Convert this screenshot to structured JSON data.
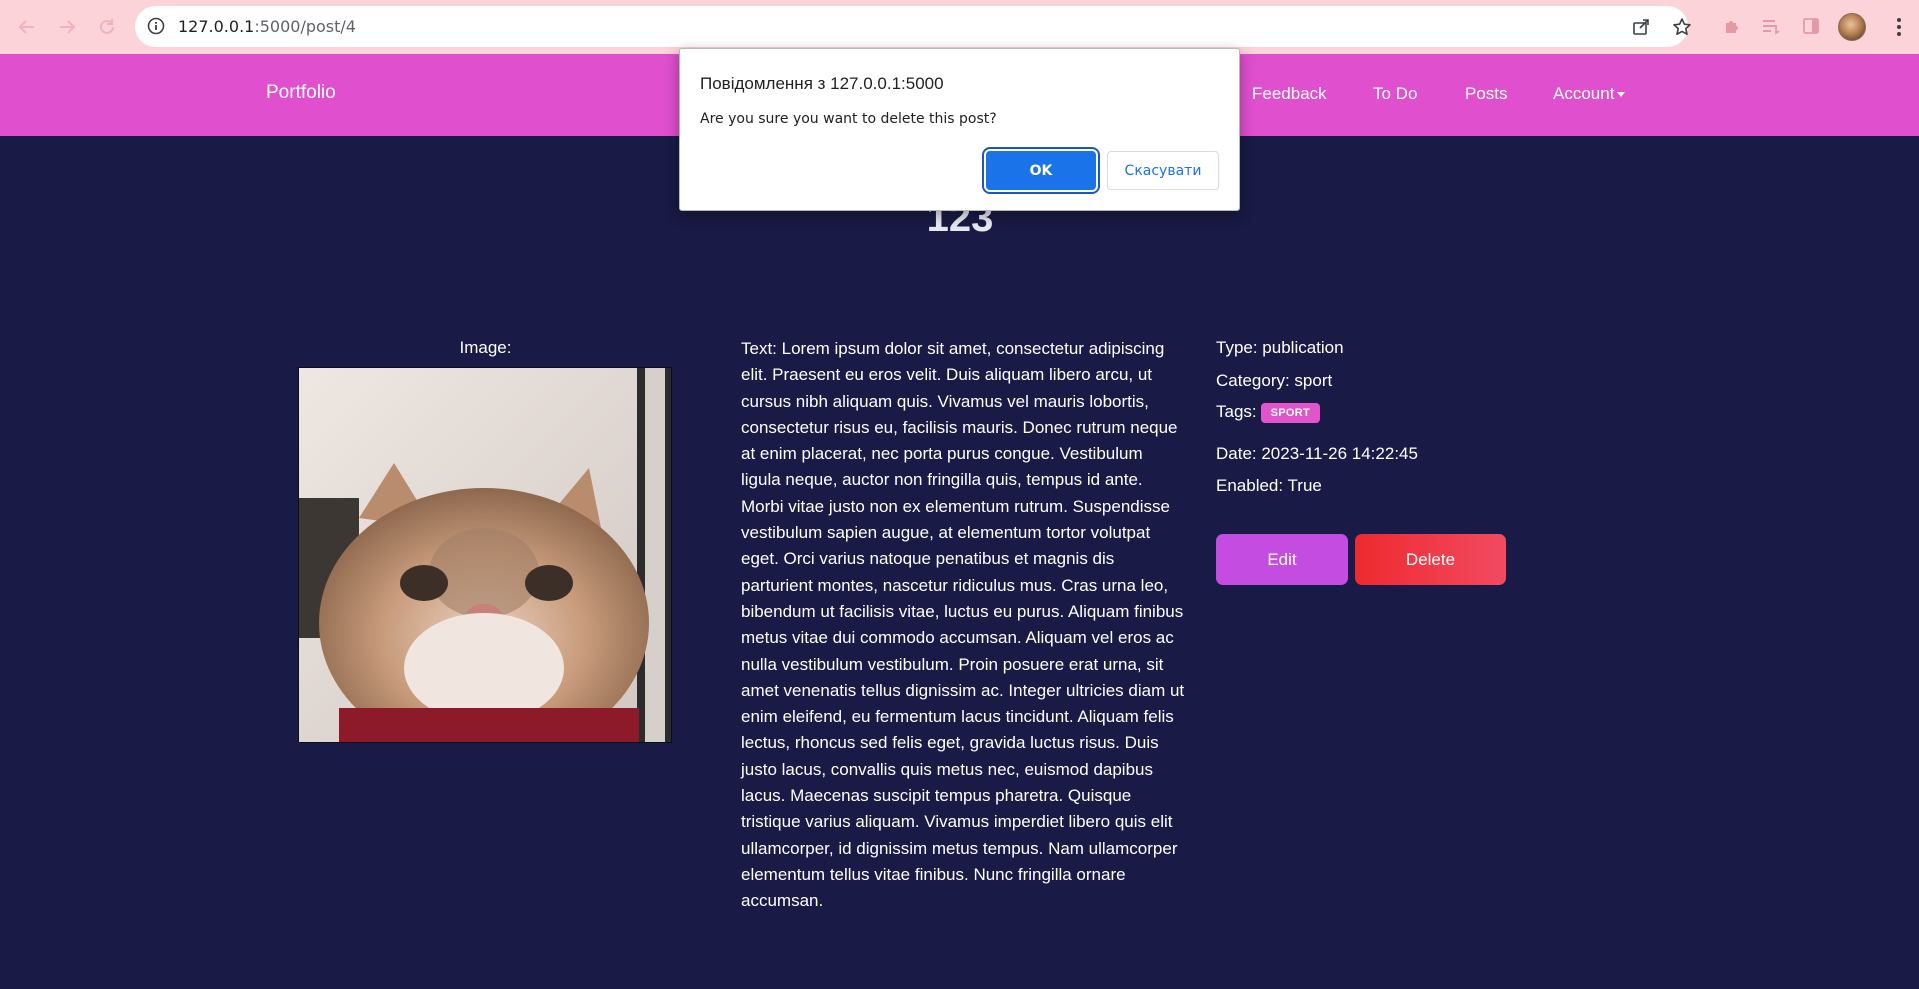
{
  "browser": {
    "url_host": "127.0.0.1",
    "url_rest": ":5000/post/4",
    "icons": [
      "back-arrow-icon",
      "forward-arrow-icon",
      "reload-icon",
      "info-icon",
      "share-icon",
      "star-icon",
      "puzzle-icon",
      "reading-list-icon",
      "side-panel-icon",
      "profile-avatar",
      "more-menu-icon"
    ]
  },
  "navbar": {
    "brand": "Portfolio",
    "links": [
      "Feedback",
      "To Do",
      "Posts"
    ],
    "account": "Account",
    "color": "#df4fce"
  },
  "post": {
    "title": "123",
    "image_label": "Image:",
    "text": "Text: Lorem ipsum dolor sit amet, consectetur adipiscing elit. Praesent eu eros velit. Duis aliquam libero arcu, ut cursus nibh aliquam quis. Vivamus vel mauris lobortis, consectetur risus eu, facilisis mauris. Donec rutrum neque at enim placerat, nec porta purus congue. Vestibulum ligula neque, auctor non fringilla quis, tempus id ante. Morbi vitae justo non ex elementum rutrum. Suspendisse vestibulum sapien augue, at elementum tortor volutpat eget. Orci varius natoque penatibus et magnis dis parturient montes, nascetur ridiculus mus. Cras urna leo, bibendum ut facilisis vitae, luctus eu purus. Aliquam finibus metus vitae dui commodo accumsan. Aliquam vel eros ac nulla vestibulum vestibulum. Proin posuere erat urna, sit amet venenatis tellus dignissim ac. Integer ultricies diam ut enim eleifend, eu fermentum lacus tincidunt. Aliquam felis lectus, rhoncus sed felis eget, gravida luctus risus. Duis justo lacus, convallis quis metus nec, euismod dapibus lacus. Maecenas suscipit tempus pharetra. Quisque tristique varius aliquam. Vivamus imperdiet libero quis elit ullamcorper, id dignissim metus tempus. Nam ullamcorper elementum tellus vitae finibus. Nunc fringilla ornare accumsan.",
    "type": "Type: publication",
    "category": "Category: sport",
    "tags_label": "Tags:",
    "tag": "SPORT",
    "date": "Date: 2023-11-26 14:22:45",
    "enabled": "Enabled: True",
    "edit_label": "Edit",
    "delete_label": "Delete",
    "background": "#191a45"
  },
  "dialog": {
    "title": "Повідомлення з 127.0.0.1:5000",
    "message": "Are you sure you want to delete this post?",
    "ok_label": "OK",
    "cancel_label": "Скасувати"
  }
}
